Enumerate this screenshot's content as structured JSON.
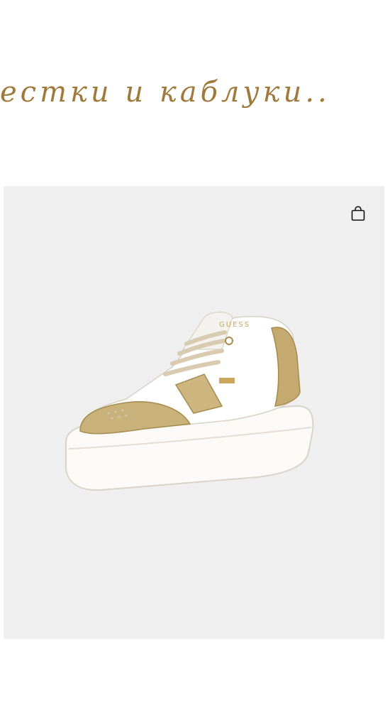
{
  "section": {
    "heading": "естки и каблуки.."
  },
  "product": {
    "image_alt": "white and gold GUESS platform sneaker",
    "brand_mark": "GUESS",
    "cart_icon": "shopping-bag-icon"
  }
}
